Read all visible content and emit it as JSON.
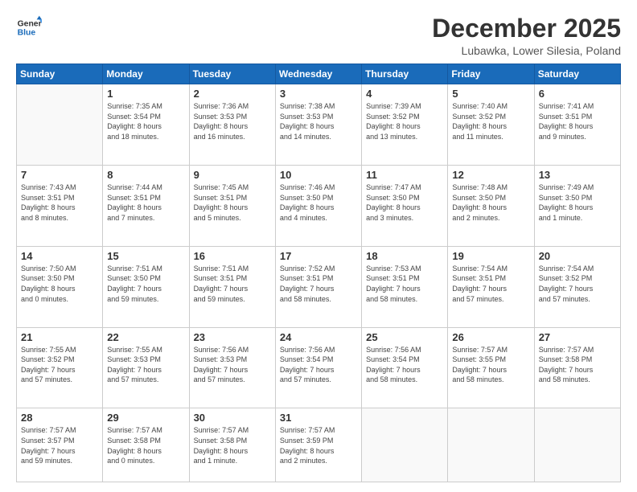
{
  "logo": {
    "line1": "General",
    "line2": "Blue"
  },
  "title": "December 2025",
  "subtitle": "Lubawka, Lower Silesia, Poland",
  "headers": [
    "Sunday",
    "Monday",
    "Tuesday",
    "Wednesday",
    "Thursday",
    "Friday",
    "Saturday"
  ],
  "weeks": [
    [
      {
        "day": "",
        "info": ""
      },
      {
        "day": "1",
        "info": "Sunrise: 7:35 AM\nSunset: 3:54 PM\nDaylight: 8 hours\nand 18 minutes."
      },
      {
        "day": "2",
        "info": "Sunrise: 7:36 AM\nSunset: 3:53 PM\nDaylight: 8 hours\nand 16 minutes."
      },
      {
        "day": "3",
        "info": "Sunrise: 7:38 AM\nSunset: 3:53 PM\nDaylight: 8 hours\nand 14 minutes."
      },
      {
        "day": "4",
        "info": "Sunrise: 7:39 AM\nSunset: 3:52 PM\nDaylight: 8 hours\nand 13 minutes."
      },
      {
        "day": "5",
        "info": "Sunrise: 7:40 AM\nSunset: 3:52 PM\nDaylight: 8 hours\nand 11 minutes."
      },
      {
        "day": "6",
        "info": "Sunrise: 7:41 AM\nSunset: 3:51 PM\nDaylight: 8 hours\nand 9 minutes."
      }
    ],
    [
      {
        "day": "7",
        "info": "Sunrise: 7:43 AM\nSunset: 3:51 PM\nDaylight: 8 hours\nand 8 minutes."
      },
      {
        "day": "8",
        "info": "Sunrise: 7:44 AM\nSunset: 3:51 PM\nDaylight: 8 hours\nand 7 minutes."
      },
      {
        "day": "9",
        "info": "Sunrise: 7:45 AM\nSunset: 3:51 PM\nDaylight: 8 hours\nand 5 minutes."
      },
      {
        "day": "10",
        "info": "Sunrise: 7:46 AM\nSunset: 3:50 PM\nDaylight: 8 hours\nand 4 minutes."
      },
      {
        "day": "11",
        "info": "Sunrise: 7:47 AM\nSunset: 3:50 PM\nDaylight: 8 hours\nand 3 minutes."
      },
      {
        "day": "12",
        "info": "Sunrise: 7:48 AM\nSunset: 3:50 PM\nDaylight: 8 hours\nand 2 minutes."
      },
      {
        "day": "13",
        "info": "Sunrise: 7:49 AM\nSunset: 3:50 PM\nDaylight: 8 hours\nand 1 minute."
      }
    ],
    [
      {
        "day": "14",
        "info": "Sunrise: 7:50 AM\nSunset: 3:50 PM\nDaylight: 8 hours\nand 0 minutes."
      },
      {
        "day": "15",
        "info": "Sunrise: 7:51 AM\nSunset: 3:50 PM\nDaylight: 7 hours\nand 59 minutes."
      },
      {
        "day": "16",
        "info": "Sunrise: 7:51 AM\nSunset: 3:51 PM\nDaylight: 7 hours\nand 59 minutes."
      },
      {
        "day": "17",
        "info": "Sunrise: 7:52 AM\nSunset: 3:51 PM\nDaylight: 7 hours\nand 58 minutes."
      },
      {
        "day": "18",
        "info": "Sunrise: 7:53 AM\nSunset: 3:51 PM\nDaylight: 7 hours\nand 58 minutes."
      },
      {
        "day": "19",
        "info": "Sunrise: 7:54 AM\nSunset: 3:51 PM\nDaylight: 7 hours\nand 57 minutes."
      },
      {
        "day": "20",
        "info": "Sunrise: 7:54 AM\nSunset: 3:52 PM\nDaylight: 7 hours\nand 57 minutes."
      }
    ],
    [
      {
        "day": "21",
        "info": "Sunrise: 7:55 AM\nSunset: 3:52 PM\nDaylight: 7 hours\nand 57 minutes."
      },
      {
        "day": "22",
        "info": "Sunrise: 7:55 AM\nSunset: 3:53 PM\nDaylight: 7 hours\nand 57 minutes."
      },
      {
        "day": "23",
        "info": "Sunrise: 7:56 AM\nSunset: 3:53 PM\nDaylight: 7 hours\nand 57 minutes."
      },
      {
        "day": "24",
        "info": "Sunrise: 7:56 AM\nSunset: 3:54 PM\nDaylight: 7 hours\nand 57 minutes."
      },
      {
        "day": "25",
        "info": "Sunrise: 7:56 AM\nSunset: 3:54 PM\nDaylight: 7 hours\nand 58 minutes."
      },
      {
        "day": "26",
        "info": "Sunrise: 7:57 AM\nSunset: 3:55 PM\nDaylight: 7 hours\nand 58 minutes."
      },
      {
        "day": "27",
        "info": "Sunrise: 7:57 AM\nSunset: 3:58 PM\nDaylight: 7 hours\nand 58 minutes."
      }
    ],
    [
      {
        "day": "28",
        "info": "Sunrise: 7:57 AM\nSunset: 3:57 PM\nDaylight: 7 hours\nand 59 minutes."
      },
      {
        "day": "29",
        "info": "Sunrise: 7:57 AM\nSunset: 3:58 PM\nDaylight: 8 hours\nand 0 minutes."
      },
      {
        "day": "30",
        "info": "Sunrise: 7:57 AM\nSunset: 3:58 PM\nDaylight: 8 hours\nand 1 minute."
      },
      {
        "day": "31",
        "info": "Sunrise: 7:57 AM\nSunset: 3:59 PM\nDaylight: 8 hours\nand 2 minutes."
      },
      {
        "day": "",
        "info": ""
      },
      {
        "day": "",
        "info": ""
      },
      {
        "day": "",
        "info": ""
      }
    ]
  ]
}
